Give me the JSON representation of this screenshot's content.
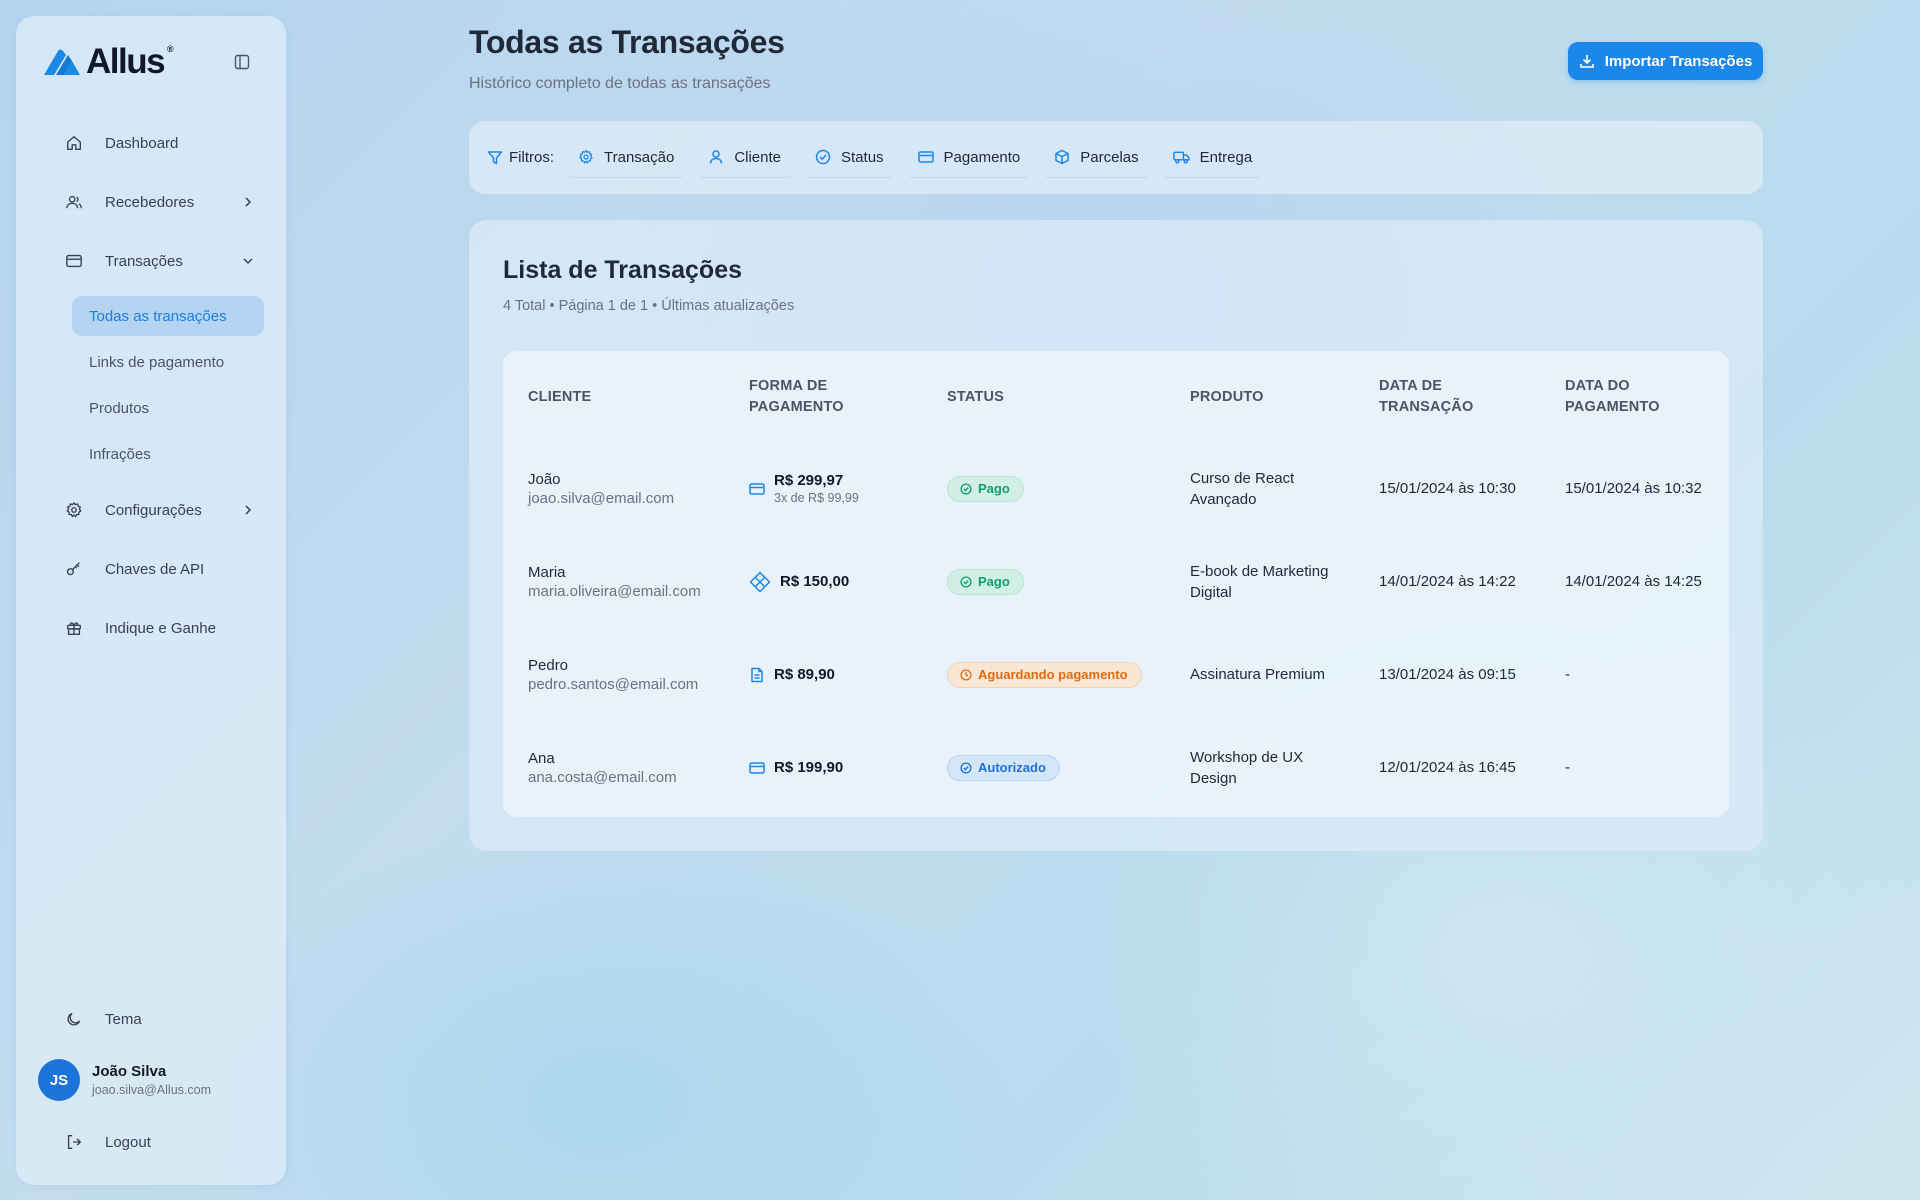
{
  "brand": {
    "name": "Allus",
    "reg": "®"
  },
  "sidebar": {
    "nav": [
      {
        "label": "Dashboard",
        "icon": "home-icon"
      },
      {
        "label": "Recebedores",
        "icon": "users-icon"
      },
      {
        "label": "Transações",
        "icon": "credit-card-icon"
      },
      {
        "label": "Configurações",
        "icon": "gear-icon"
      },
      {
        "label": "Chaves de API",
        "icon": "key-icon"
      },
      {
        "label": "Indique e Ganhe",
        "icon": "gift-icon"
      }
    ],
    "sub": [
      {
        "label": "Todas as transações",
        "active": true
      },
      {
        "label": "Links de pagamento"
      },
      {
        "label": "Produtos"
      },
      {
        "label": "Infrações"
      }
    ],
    "theme_label": "Tema",
    "logout_label": "Logout",
    "user": {
      "initials": "JS",
      "name": "João Silva",
      "email": "joao.silva@Allus.com"
    }
  },
  "header": {
    "title": "Todas as Transações",
    "subtitle": "Histórico completo de todas as transações",
    "import_label": "Importar Transações"
  },
  "filters": {
    "label": "Filtros:",
    "chips": [
      "Transação",
      "Cliente",
      "Status",
      "Pagamento",
      "Parcelas",
      "Entrega"
    ]
  },
  "list": {
    "title": "Lista de Transações",
    "meta": "4 Total • Página 1 de 1 • Últimas atualizações",
    "columns": {
      "cliente": "CLIENTE",
      "forma_1": "FORMA DE",
      "forma_2": "PAGAMENTO",
      "status": "STATUS",
      "produto": "PRODUTO",
      "data_t_1": "DATA DE",
      "data_t_2": "TRANSAÇÃO",
      "data_p_1": "DATA DO",
      "data_p_2": "PAGAMENTO"
    },
    "rows": [
      {
        "name": "João",
        "email": "joao.silva@email.com",
        "amount": "R$ 299,97",
        "installments": "3x de R$ 99,99",
        "method": "card",
        "status": "Pago",
        "status_color": "#0f9f6e",
        "product_1": "Curso de React",
        "product_2": "Avançado",
        "tx_date": "15/01/2024 às 10:30",
        "pay_date": "15/01/2024 às 10:32"
      },
      {
        "name": "Maria",
        "email": "maria.oliveira@email.com",
        "amount": "R$ 150,00",
        "installments": "",
        "method": "pix",
        "status": "Pago",
        "status_color": "#0f9f6e",
        "product_1": "E-book de Marketing",
        "product_2": "Digital",
        "tx_date": "14/01/2024 às 14:22",
        "pay_date": "14/01/2024 às 14:25"
      },
      {
        "name": "Pedro",
        "email": "pedro.santos@email.com",
        "amount": "R$ 89,90",
        "installments": "",
        "method": "boleto",
        "status": "Aguardando pagamento",
        "status_color": "#e06b10",
        "product_1": "Assinatura Premium",
        "product_2": "",
        "tx_date": "13/01/2024 às 09:15",
        "pay_date": "-"
      },
      {
        "name": "Ana",
        "email": "ana.costa@email.com",
        "amount": "R$ 199,90",
        "installments": "",
        "method": "card",
        "status": "Autorizado",
        "status_color": "#1c72d6",
        "product_1": "Workshop de UX",
        "product_2": "Design",
        "tx_date": "12/01/2024 às 16:45",
        "pay_date": "-"
      }
    ]
  },
  "colors": {
    "accent": "#1b87e8",
    "avatar": "#1c73d9"
  }
}
